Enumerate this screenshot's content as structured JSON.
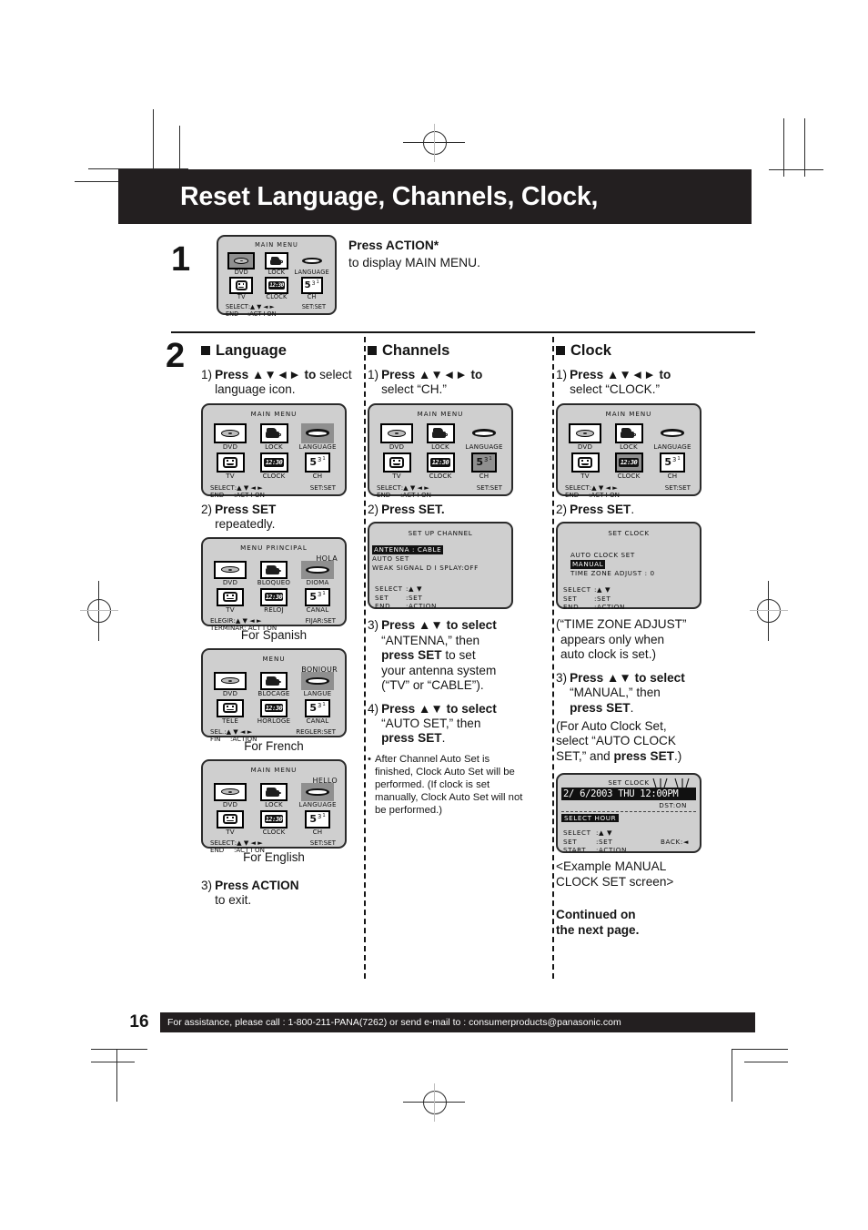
{
  "header": {
    "title": "Reset Language, Channels, Clock,"
  },
  "steps": {
    "one": "1",
    "two": "2"
  },
  "step1": {
    "instruction_bold": "Press ACTION*",
    "instruction_rest": "to display MAIN MENU."
  },
  "menu_labels": {
    "select": "SELECT",
    "end": "END",
    "set": "SET:SET",
    "action": ":ACTION",
    "arrows": ":▲ ▼ ◄ ►",
    "clock_glyph": "12:30"
  },
  "main_menu_en": {
    "title": "MAIN MENU",
    "items": [
      "DVD",
      "LOCK",
      "LANGUAGE",
      "TV",
      "CLOCK",
      "CH"
    ],
    "ch_digits": {
      "main": "5",
      "sup1": "3",
      "sup2": "1"
    },
    "foot": {
      "l1a": "SELECT",
      "l1b": ":▲ ▼ ◄ ►",
      "l1c": "SET:SET",
      "l2a": "END",
      "l2b": ":ACT I ON"
    }
  },
  "language": {
    "heading": "Language",
    "step1_mark": "1)",
    "step1_bold": "Press ▲▼◄► to",
    "step1_rest": "select language icon.",
    "step2_mark": "2)",
    "step2_bold": "Press SET",
    "step2_rest": "repeatedly.",
    "step3_mark": "3)",
    "step3_bold": "Press ACTION",
    "step3_rest": "to exit.",
    "captions": {
      "spanish": "For Spanish",
      "french": "For French",
      "english": "For English"
    },
    "menu_spanish": {
      "title": "MENU  PRINCIPAL",
      "greeting": "HOLA",
      "items": [
        "DVD",
        "BLOQUEO",
        "DIOMA",
        "TV",
        "RELOJ",
        "CANAL"
      ],
      "foot": {
        "l1a": "ELEGIR",
        "l1b": ":▲ ▼ ◄ ►",
        "l1c": "FIJAR:SET",
        "l2a": "TERMINAR",
        "l2b": ": ACT I ON"
      }
    },
    "menu_french": {
      "title": "MENU",
      "greeting": "BONJOUR",
      "items": [
        "DVD",
        "BLOCAGE",
        "LANGUE",
        "TELE",
        "HORLOGE",
        "CANAL"
      ],
      "foot": {
        "l1a": "SEL.",
        "l1b": ":▲ ▼ ◄ ►",
        "l1c": "REGLER:SET",
        "l2a": "FIN",
        "l2b": ":ACTION"
      }
    },
    "menu_english": {
      "title": "MAIN MENU",
      "greeting": "HELLO",
      "items": [
        "DVD",
        "LOCK",
        "LANGUAGE",
        "TV",
        "CLOCK",
        "CH"
      ],
      "foot": {
        "l1a": "SELECT",
        "l1b": ":▲ ▼ ◄ ►",
        "l1c": "SET:SET",
        "l2a": "END",
        "l2b": ":ACT I ON"
      }
    }
  },
  "channels": {
    "heading": "Channels",
    "step1_mark": "1)",
    "step1_bold": "Press ▲▼◄► to",
    "step1_rest": "select “CH.”",
    "step2_mark": "2)",
    "step2_bold": "Press SET.",
    "step3_mark": "3)",
    "step3_bold": "Press ▲▼ to select",
    "step3_l2": "“ANTENNA,” then",
    "step3_l3_bold": "press SET",
    "step3_l3_rest": " to set",
    "step3_l4": "your antenna system",
    "step3_l5": "(“TV” or “CABLE”).",
    "step4_mark": "4)",
    "step4_bold": "Press ▲▼ to select",
    "step4_l2": "“AUTO SET,” then",
    "step4_l3_bold": "press SET",
    "step4_l3_rest": ".",
    "note": "After Channel Auto Set is finished, Clock Auto Set will be performed. (If clock is set manually, Clock Auto Set will not be performed.)",
    "setup_screen": {
      "title": "SET  UP  CHANNEL",
      "row1": "ANTENNA  :  CABLE",
      "row2": "AUTO  SET",
      "row3": "WEAK  SIGNAL  D I SPLAY:OFF",
      "foot1a": "SELECT",
      "foot1b": ":▲ ▼",
      "foot2a": "SET",
      "foot2b": ":SET",
      "foot3a": "END",
      "foot3b": ":ACTION"
    }
  },
  "clock": {
    "heading": "Clock",
    "step1_mark": "1)",
    "step1_bold": "Press ▲▼◄► to",
    "step1_rest": "select “CLOCK.”",
    "step2_mark": "2)",
    "step2_bold": "Press SET",
    "step2_rest": ".",
    "note1_l1": "(“TIME ZONE ADJUST”",
    "note1_l2": "appears only when",
    "note1_l3": "auto clock is set.)",
    "step3_mark": "3)",
    "step3_bold": "Press ▲▼ to select",
    "step3_l2": "“MANUAL,” then",
    "step3_l3_bold": "press SET",
    "step3_l3_rest": ".",
    "note2_l1": "(For Auto Clock Set,",
    "note2_l2": "select “AUTO CLOCK",
    "note2_l3_a": "SET,” and ",
    "note2_l3_b": "press SET",
    "note2_l3_c": ".)",
    "example_l1": "<Example MANUAL",
    "example_l2": "CLOCK SET screen>",
    "continued_l1": "Continued on",
    "continued_l2": "the next page.",
    "set_clock_screen": {
      "title": "SET  CLOCK",
      "row1": "AUTO  CLOCK  SET",
      "row2": "MANUAL",
      "row3": "TIME  ZONE  ADJUST  : 0",
      "foot1a": "SELECT",
      "foot1b": ":▲ ▼",
      "foot2a": "SET",
      "foot2b": ":SET",
      "foot3a": "END",
      "foot3b": ":ACTION"
    },
    "manual_clock_screen": {
      "title": "SET  CLOCK",
      "datetime": "2/  6/2003 THU  12:00PM",
      "dst": "DST:ON",
      "select_hour": "SELECT HOUR",
      "foot1a": "SELECT",
      "foot1b": ":▲ ▼",
      "foot2a": "SET",
      "foot2b": ":SET",
      "foot3a": "START",
      "foot3b": ":ACTION",
      "back": "BACK:◄"
    }
  },
  "footer": {
    "page_number": "16",
    "assistance": "For assistance, please call : 1-800-211-PANA(7262) or send e-mail to : consumerproducts@panasonic.com"
  }
}
